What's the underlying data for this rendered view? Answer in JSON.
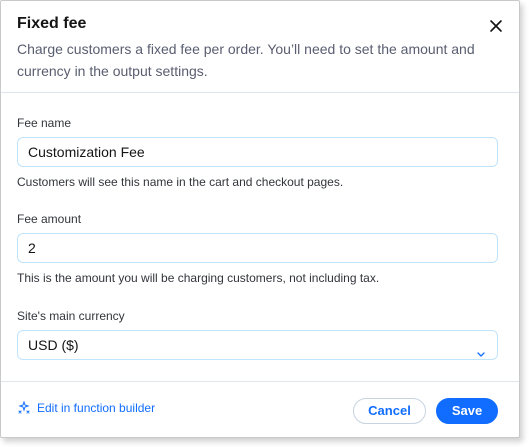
{
  "dialog": {
    "title": "Fixed fee",
    "subtitle": "Charge customers a fixed fee per order. You’ll need to set the amount and currency in the output settings."
  },
  "fee_name": {
    "label": "Fee name",
    "value": "Customization Fee",
    "help": "Customers will see this name in the cart and checkout pages."
  },
  "fee_amount": {
    "label": "Fee amount",
    "value": "2",
    "help": "This is the amount you will be charging customers, not including tax."
  },
  "currency": {
    "label": "Site's main currency",
    "selected": "USD ($)"
  },
  "footer": {
    "link_label": "Edit in function builder",
    "cancel_label": "Cancel",
    "save_label": "Save"
  },
  "colors": {
    "accent": "#116dff",
    "input_border": "#c1e4fe"
  },
  "icons": {
    "close": "close-icon",
    "dropdown": "chevron-down-icon",
    "link": "function-builder-icon"
  }
}
